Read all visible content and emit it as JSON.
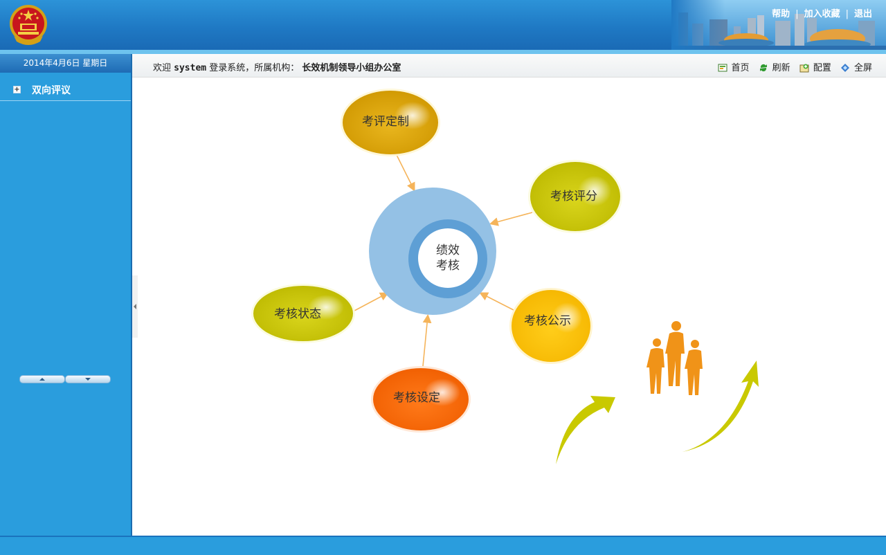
{
  "header": {
    "top_links": [
      "帮助",
      "加入收藏",
      "退出"
    ]
  },
  "sidebar": {
    "date": "2014年4月6日  星期日",
    "menu_item": "双向评议"
  },
  "subbar": {
    "welcome_prefix": "欢迎",
    "user": "system",
    "welcome_mid": "登录系统，所属机构：",
    "org": "长效机制领导小组办公室",
    "tools": [
      "首页",
      "刷新",
      "配置",
      "全屏"
    ]
  },
  "diagram": {
    "center_line1": "绩效",
    "center_line2": "考核",
    "nodes": [
      "考评定制",
      "考核评分",
      "考核公示",
      "考核设定",
      "考核状态"
    ]
  },
  "colors": {
    "header_blue": "#1f79c4",
    "sidebar_blue": "#2a9ddd",
    "node_gold": "#daa300",
    "node_olive": "#cfcb0c",
    "node_yellow": "#fcc100",
    "node_orange": "#fe6a08",
    "center_ring": "#94c1e5",
    "people_orange": "#f09318",
    "arrow_olive": "#c9c900"
  }
}
